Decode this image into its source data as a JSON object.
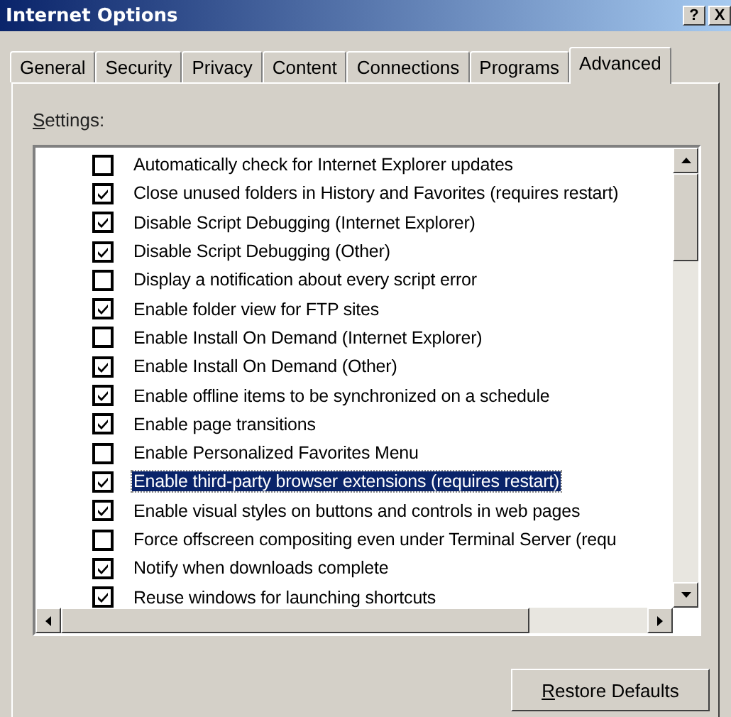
{
  "window": {
    "title": "Internet Options",
    "buttons": [
      "?",
      "X"
    ]
  },
  "tabs": [
    {
      "label": "General",
      "selected": false
    },
    {
      "label": "Security",
      "selected": false
    },
    {
      "label": "Privacy",
      "selected": false
    },
    {
      "label": "Content",
      "selected": false
    },
    {
      "label": "Connections",
      "selected": false
    },
    {
      "label": "Programs",
      "selected": false
    },
    {
      "label": "Advanced",
      "selected": true
    }
  ],
  "settings": {
    "label": "Settings:",
    "items": [
      {
        "label": "Automatically check for Internet Explorer updates",
        "checked": false,
        "selected": false
      },
      {
        "label": "Close unused folders in History and Favorites (requires restart)",
        "checked": true,
        "selected": false
      },
      {
        "label": "Disable Script Debugging (Internet Explorer)",
        "checked": true,
        "selected": false
      },
      {
        "label": "Disable Script Debugging (Other)",
        "checked": true,
        "selected": false
      },
      {
        "label": "Display a notification about every script error",
        "checked": false,
        "selected": false
      },
      {
        "label": "Enable folder view for FTP sites",
        "checked": true,
        "selected": false
      },
      {
        "label": "Enable Install On Demand (Internet Explorer)",
        "checked": false,
        "selected": false
      },
      {
        "label": "Enable Install On Demand (Other)",
        "checked": true,
        "selected": false
      },
      {
        "label": "Enable offline items to be synchronized on a schedule",
        "checked": true,
        "selected": false
      },
      {
        "label": "Enable page transitions",
        "checked": true,
        "selected": false
      },
      {
        "label": "Enable Personalized Favorites Menu",
        "checked": false,
        "selected": false
      },
      {
        "label": "Enable third-party browser extensions (requires restart)",
        "checked": true,
        "selected": true
      },
      {
        "label": "Enable visual styles on buttons and controls in web pages",
        "checked": true,
        "selected": false
      },
      {
        "label": "Force offscreen compositing even under Terminal Server (requ",
        "checked": false,
        "selected": false
      },
      {
        "label": "Notify when downloads complete",
        "checked": true,
        "selected": false
      },
      {
        "label": "Reuse windows for launching shortcuts",
        "checked": true,
        "selected": false
      }
    ]
  },
  "buttons": [
    "Restore Defaults"
  ]
}
